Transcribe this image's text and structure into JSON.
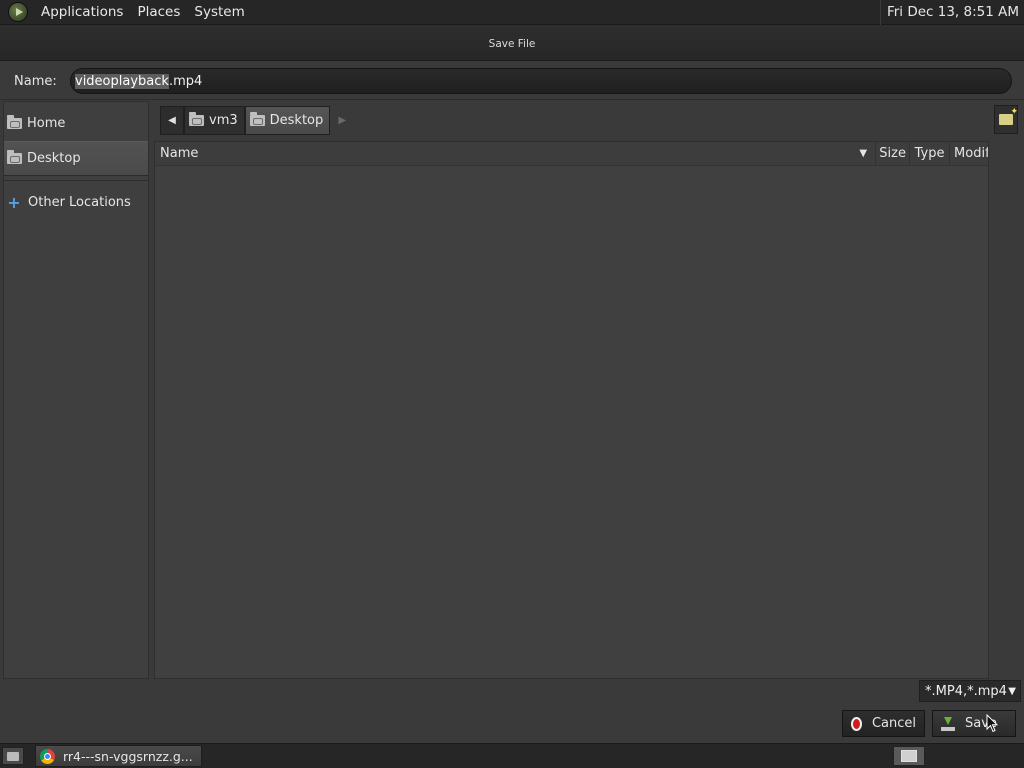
{
  "top_panel": {
    "menus": [
      "Applications",
      "Places",
      "System"
    ],
    "clock": "Fri Dec 13,  8:51 AM"
  },
  "dialog": {
    "title": "Save File",
    "name_label": "Name:",
    "filename_selected": "videoplayback",
    "filename_rest": ".mp4",
    "sidebar": {
      "items": [
        {
          "label": "Home",
          "icon": "folder-icon"
        },
        {
          "label": "Desktop",
          "icon": "folder-icon",
          "selected": true
        },
        {
          "label": "Other Locations",
          "icon": "plus-icon"
        }
      ]
    },
    "pathbar": {
      "segments": [
        "vm3",
        "Desktop"
      ],
      "active": "Desktop"
    },
    "columns": [
      "Name",
      "Size",
      "Type",
      "Modif"
    ],
    "filter": "*.MP4,*.mp4",
    "buttons": {
      "cancel": "Cancel",
      "save": "Save"
    }
  },
  "taskbar": {
    "task_title": "rr4---sn-vggsrnzz.g..."
  }
}
